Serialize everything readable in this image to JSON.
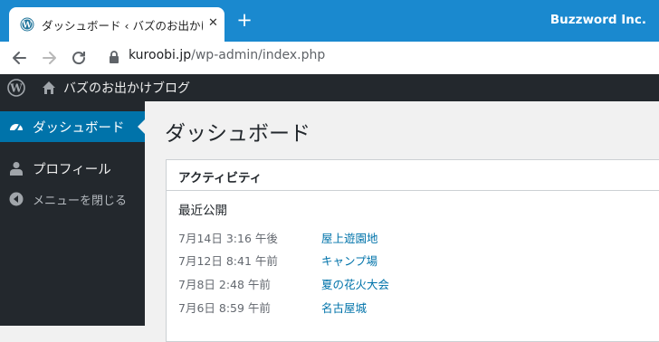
{
  "browser": {
    "tab_title": "ダッシュボード ‹ バズのお出かけブログ —",
    "new_tab_label": "+",
    "account_name": "Buzzword Inc.",
    "url_host": "kuroobi.jp",
    "url_path": "/wp-admin/index.php",
    "accent_color": "#1a89cf"
  },
  "adminbar": {
    "site_name": "バズのお出かけブログ"
  },
  "sidebar": {
    "items": [
      {
        "label": "ダッシュボード",
        "icon": "dashboard-icon",
        "current": true
      },
      {
        "label": "プロフィール",
        "icon": "user-icon",
        "current": false
      }
    ],
    "collapse_label": "メニューを閉じる"
  },
  "main": {
    "page_title": "ダッシュボード",
    "activity": {
      "title": "アクティビティ",
      "recent_title": "最近公開",
      "items": [
        {
          "date": "7月14日 3:16 午後",
          "title": "屋上遊園地"
        },
        {
          "date": "7月12日 8:41 午前",
          "title": "キャンプ場"
        },
        {
          "date": "7月8日 2:48 午前",
          "title": "夏の花火大会"
        },
        {
          "date": "7月6日 8:59 午前",
          "title": "名古屋城"
        }
      ]
    }
  }
}
